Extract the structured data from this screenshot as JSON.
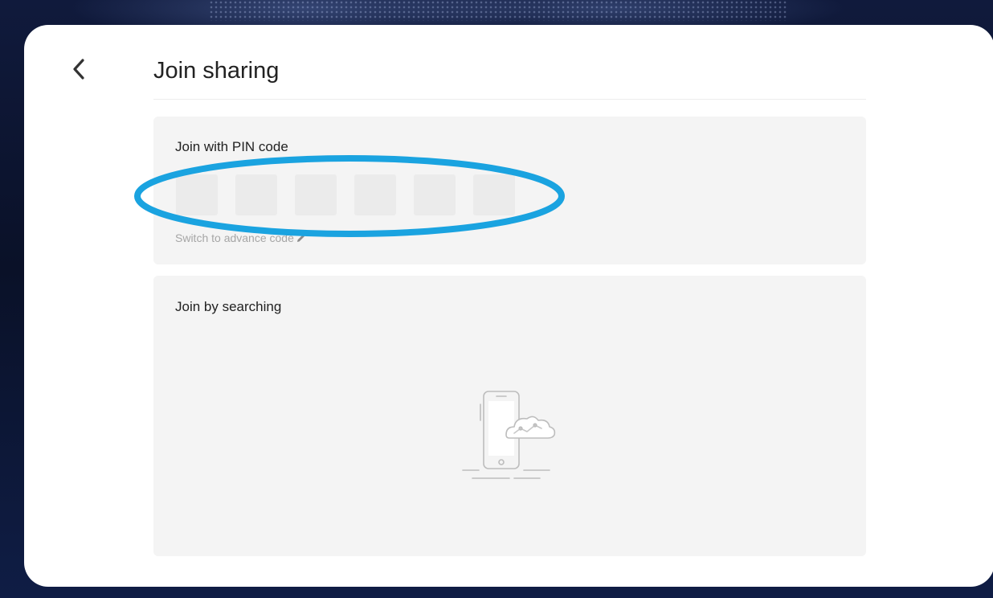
{
  "header": {
    "title": "Join sharing",
    "back_icon": "chevron-left-icon"
  },
  "pin_section": {
    "title": "Join with PIN code",
    "pin_digits": [
      "",
      "",
      "",
      "",
      "",
      ""
    ],
    "switch_link": "Switch to advance code",
    "switch_icon": "pencil-icon"
  },
  "search_section": {
    "title": "Join by searching",
    "illustration_icon": "phone-cloud-icon"
  },
  "colors": {
    "background": "#0b1330",
    "card": "#ffffff",
    "panel": "#f4f4f4",
    "pin_box": "#ebebeb",
    "highlight": "#1aa3e0"
  }
}
